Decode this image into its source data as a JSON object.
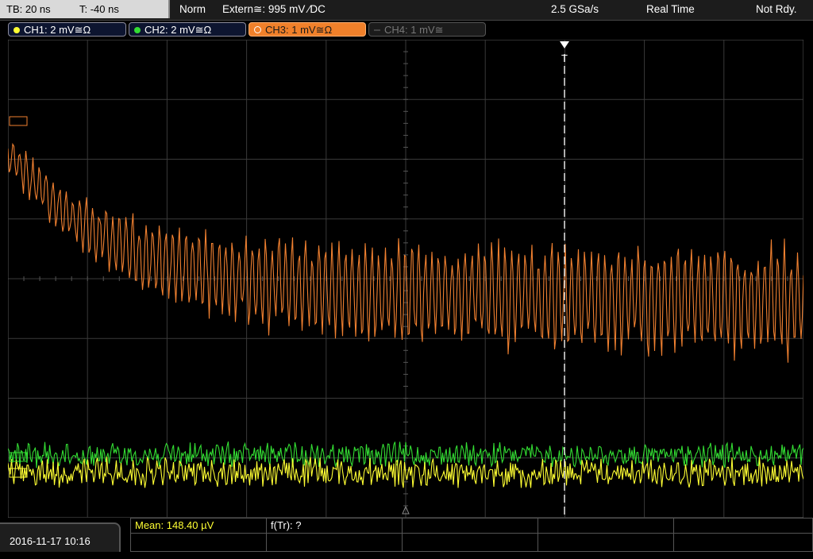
{
  "header": {
    "timebase": "TB: 20 ns",
    "trigger_time": "T: -40 ns",
    "trigger_mode": "Norm",
    "trigger_source": "Extern≅: 995 mV ∕DC",
    "sample_rate": "2.5 GSa/s",
    "acq_mode": "Real Time",
    "status": "Not Rdy."
  },
  "channels": [
    {
      "label": "CH1: 2 mV≅Ω",
      "color": "#ffff33",
      "active": true
    },
    {
      "label": "CH2: 2 mV≅Ω",
      "color": "#33dd33",
      "active": true
    },
    {
      "label": "CH3: 1 mV≅Ω",
      "color": "#f0802a",
      "active": true,
      "selected": true
    },
    {
      "label": "CH4: 1 mV≅",
      "color": "#777777",
      "active": false
    }
  ],
  "trigger_marker": "T",
  "measurements": {
    "mean": "Mean: 148.40 µV",
    "ftr": "f(Tr): ?"
  },
  "datetime": "2016-11-17 10:16",
  "colors": {
    "ch1": "#ffff33",
    "ch2": "#33dd33",
    "ch3": "#f08030",
    "grid": "#3a3a3a",
    "background": "#000000"
  }
}
